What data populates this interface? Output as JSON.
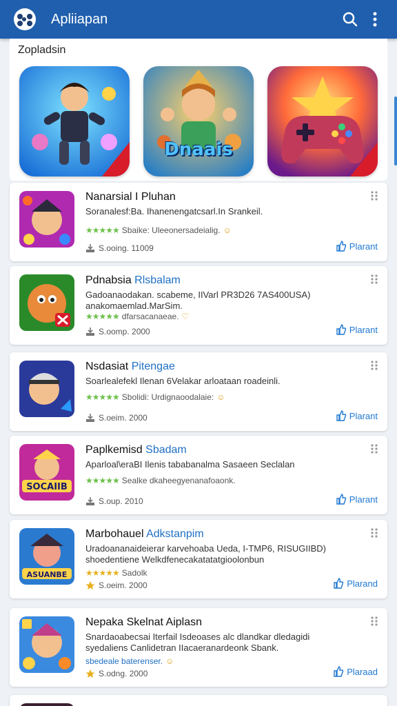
{
  "appbar": {
    "title": "Apliiapan",
    "icons": [
      "app-logo-icon",
      "search-icon",
      "more-vert-icon"
    ],
    "color": "#1f5fae"
  },
  "featured": {
    "title": "Zopladsin",
    "items": [
      {
        "label": "",
        "icon": "hero-game-icon"
      },
      {
        "label": "Dnaais",
        "icon": "adventure-game-icon"
      },
      {
        "label": "",
        "icon": "gamepad-icon"
      }
    ]
  },
  "apps": [
    {
      "name": "Nanarsial I Pluhan",
      "name_hl": "",
      "desc": "Soranalesf:Ba. Ihanenengatcsarl.In Srankeil.",
      "rating": "Sbaike: Uleeonersadeialig.",
      "meta": "S.ooing. 11009",
      "action": "Plarant",
      "meta_icon": "download-icon"
    },
    {
      "name": "Pdnabsia",
      "name_hl": "Rlsbalam",
      "desc": "Gadoanaodakan. scabeme, IIVarl PR3D26 7AS400USA) anakomaemlad.MarSim.",
      "rating": "dfarsacanaeae.",
      "meta": "S.oomp. 2000",
      "action": "Plarant",
      "meta_icon": "download-icon"
    },
    {
      "name": "Nsdasiat",
      "name_hl": "Pitengae",
      "desc": "Soarlealefekl Ilenan 6Velakar arloataan roadeinli.",
      "rating": "Sbolidi: Urdignaoodalaie:",
      "meta": "S.oeim. 2000",
      "action": "Plarant",
      "meta_icon": "download-icon"
    },
    {
      "name": "Paplkemisd",
      "name_hl": "Sbadam",
      "desc": "Aparloal\\eraBI Ilenis tababanalma Sasaeen Seclalan",
      "rating": "Sealke dkaheegyenanafoaonk.",
      "meta": "S.oup. 2010",
      "action": "Plarant",
      "meta_icon": "download-icon"
    },
    {
      "name": "Marbohauel",
      "name_hl": "Adkstanpim",
      "desc": "Uradoananaideierar karvehoaba Ueda, I-TMP6, RISUGIIBD) shoedentiene Welkdfenecakatatatgioolonbun",
      "rating": "Sadolk",
      "meta": "S.oeim. 2000",
      "action": "Plarand",
      "meta_icon": "star-icon"
    },
    {
      "name": "Nepaka Skelnat Aiplasn",
      "name_hl": "",
      "desc": "Snardaoabecsai Iterfail Isdeoases alc dlandkar dledagidi syedaliens Canlidetran IIacaeranardeonk Sbank.",
      "rating": "sbedeale baterenser.",
      "meta": "S.odng. 2000",
      "action": "Plaraad",
      "meta_icon": "star-icon"
    }
  ]
}
